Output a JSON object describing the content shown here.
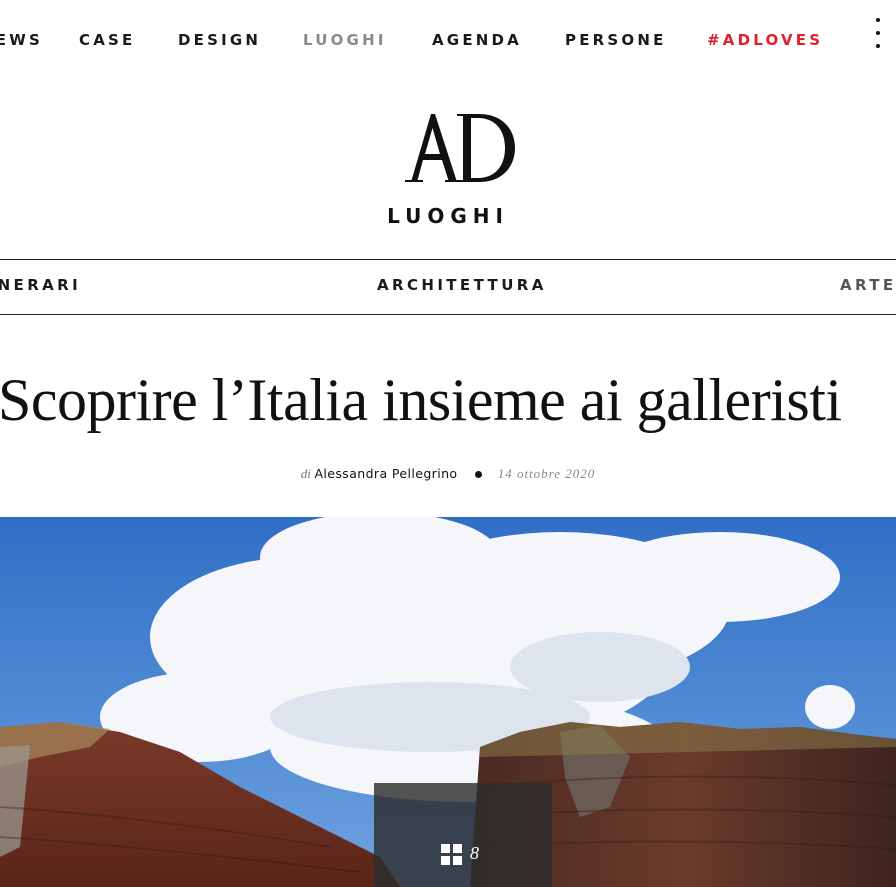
{
  "top_nav": {
    "items": [
      {
        "label": "NEWS"
      },
      {
        "label": "CASE"
      },
      {
        "label": "DESIGN"
      },
      {
        "label": "LUOGHI",
        "active": true
      },
      {
        "label": "AGENDA"
      },
      {
        "label": "PERSONE"
      },
      {
        "label": "#ADLOVES"
      }
    ],
    "more_icon": "kebab-menu-icon"
  },
  "brand": {
    "logo_text": "AD",
    "section": "LUOGHI"
  },
  "sub_nav": {
    "items": [
      {
        "label": "ITINERARI"
      },
      {
        "label": "ARCHITETTURA"
      },
      {
        "label": "ARTE"
      }
    ]
  },
  "article": {
    "title": "Scoprire l’Italia insieme ai galleristi",
    "byline_prefix": "di",
    "author": "Alessandra Pellegrino",
    "date": "14 ottobre 2020"
  },
  "gallery": {
    "icon": "gallery-grid-icon",
    "count": "8"
  },
  "colors": {
    "accent_red": "#e0202a",
    "active_gray": "#8a8a8a",
    "sky_blue": "#3a78c8"
  }
}
